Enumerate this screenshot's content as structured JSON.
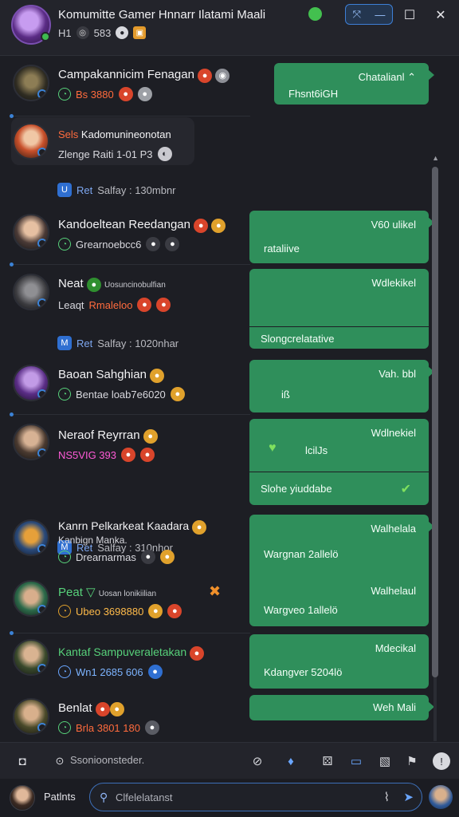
{
  "window": {
    "title": "Komumitte Gamer Hnnarr Ilatami Maali",
    "subtitle_a": "H1",
    "subtitle_b": "583",
    "min_label": "—",
    "max_label": "☐",
    "close_label": "✕",
    "pill_left": "⤧",
    "pill_right": "—"
  },
  "messages": [
    {
      "name": "Campakannicim Fenagan",
      "meta": "Bs 3880",
      "bubble_top": "Chatalianl ⌃",
      "bubble_bottom": "Fhsnt6iGH"
    },
    {
      "card_title": "Sels",
      "card_line1": "Kadomunineonotan",
      "card_line2": "Zlenge Raiti 1-01 P3",
      "sys_tag": "Ret",
      "sys_text": "Salfay : 130mbnr"
    },
    {
      "name": "Kandoeltean Reedangan",
      "meta": "Grearnoebcc6",
      "bubble_top": "V60 ulikel",
      "bubble_bottom": "rataliive"
    },
    {
      "name": "Neat",
      "sub": "Uosuncinobulfian",
      "meta_a": "Leaqt",
      "meta_b": "Rmaleloo",
      "bubble_top": "Wdlekikel",
      "bubble_bottom": "Slongcrelatative",
      "sys_tag": "Ret",
      "sys_text": "Salfay : 1020nhar"
    },
    {
      "name": "Baoan Sahghian",
      "meta": "Bentae loab7e6020",
      "bubble_top": "Vah. bbl",
      "bubble_bottom": "iß"
    },
    {
      "name": "Neraof Reyrran",
      "meta": "NS5VIG 393",
      "bubble_top": "Wdlnekiel",
      "bubble_mid": "lcilJs",
      "bubble_bottom": "Slohe yiuddabe",
      "sys_tag": "Ret",
      "sys_text": "Salfay : 310nhor"
    },
    {
      "name": "Kanrn Pelkarkeat Kaadara",
      "sub": "Kanbign Manka.",
      "meta": "Drearnarmas",
      "bubble_top": "Walhelala",
      "bubble_bottom": "Wargnan 2allelö"
    },
    {
      "name": "Peat",
      "sub": "Uosan lonikiilian",
      "meta": "Ubeo 3698880",
      "bubble_top": "Walhelaul",
      "bubble_bottom": "Wargveo 1allelö"
    },
    {
      "name": "Kantaf Sampuveraletakan",
      "meta": "Wn1 2685 606",
      "bubble_top": "Mdecikal",
      "bubble_bottom": "Kdangver 5204lö"
    },
    {
      "name": "Benlat",
      "meta": "Brla 3801 180",
      "bubble_top": "Weh Mali"
    }
  ],
  "toolbar": {
    "search_text": "Ssonioonsteder."
  },
  "composer": {
    "me_label": "Patlnts",
    "placeholder": "Clfelelatanst"
  },
  "colors": {
    "bubble": "#2f8f5b",
    "accent": "#3b82d6",
    "background": "#1d1e24"
  }
}
